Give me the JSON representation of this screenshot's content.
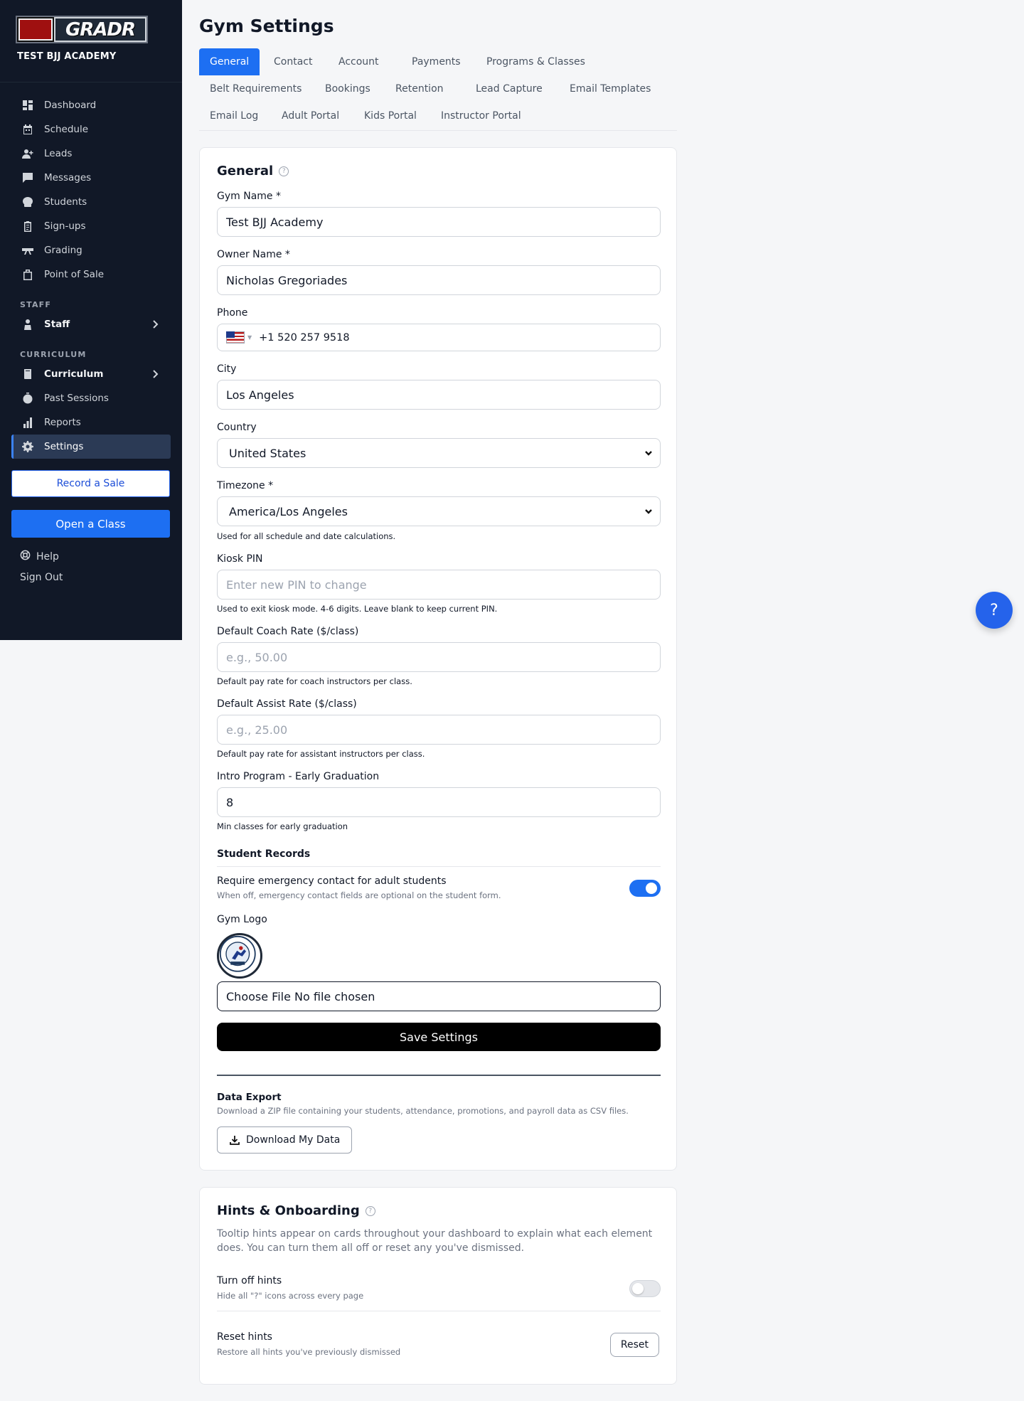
{
  "sidebar": {
    "logo_text": "GRADR",
    "gym_name": "TEST BJJ ACADEMY",
    "items": [
      {
        "label": "Dashboard",
        "icon": "dashboard-icon"
      },
      {
        "label": "Schedule",
        "icon": "calendar-icon"
      },
      {
        "label": "Leads",
        "icon": "person-add-icon"
      },
      {
        "label": "Messages",
        "icon": "chat-icon"
      },
      {
        "label": "Students",
        "icon": "users-icon"
      },
      {
        "label": "Sign-ups",
        "icon": "clipboard-icon"
      },
      {
        "label": "Grading",
        "icon": "belt-icon"
      },
      {
        "label": "Point of Sale",
        "icon": "shopping-bag-icon"
      }
    ],
    "staff_section": "STAFF",
    "staff_item": "Staff",
    "curriculum_section": "CURRICULUM",
    "curriculum_item": "Curriculum",
    "past_sessions": "Past Sessions",
    "reports": "Reports",
    "settings": "Settings",
    "record_sale": "Record a Sale",
    "open_class": "Open a Class",
    "help": "Help",
    "sign_out": "Sign Out"
  },
  "page": {
    "title": "Gym Settings",
    "tabs": [
      "General",
      "Contact",
      "Account",
      "Payments",
      "Programs & Classes",
      "Belt Requirements",
      "Bookings",
      "Retention",
      "Lead Capture",
      "Email Templates",
      "Email Log",
      "Adult Portal",
      "Kids Portal",
      "Instructor Portal"
    ],
    "active_tab": "General"
  },
  "general": {
    "title": "General",
    "gym_name_label": "Gym Name *",
    "gym_name_value": "Test BJJ Academy",
    "owner_label": "Owner Name *",
    "owner_value": "Nicholas Gregoriades",
    "phone_label": "Phone",
    "phone_value": "+1 520 257 9518",
    "city_label": "City",
    "city_value": "Los Angeles",
    "country_label": "Country",
    "country_value": "United States",
    "timezone_label": "Timezone *",
    "timezone_value": "America/Los Angeles",
    "timezone_hint": "Used for all schedule and date calculations.",
    "kiosk_label": "Kiosk PIN",
    "kiosk_placeholder": "Enter new PIN to change",
    "kiosk_hint": "Used to exit kiosk mode. 4-6 digits. Leave blank to keep current PIN.",
    "coach_label": "Default Coach Rate ($/class)",
    "coach_placeholder": "e.g., 50.00",
    "coach_hint": "Default pay rate for coach instructors per class.",
    "assist_label": "Default Assist Rate ($/class)",
    "assist_placeholder": "e.g., 25.00",
    "assist_hint": "Default pay rate for assistant instructors per class.",
    "intro_label": "Intro Program - Early Graduation",
    "intro_value": "8",
    "intro_hint": "Min classes for early graduation",
    "student_records": "Student Records",
    "emergency_label": "Require emergency contact for adult students",
    "emergency_hint": "When off, emergency contact fields are optional on the student form.",
    "emergency_on": true,
    "logo_label": "Gym Logo",
    "logo_badge_text": "TEST JIU-JITSU ACADEMY",
    "file_value": "Choose File No file chosen",
    "save": "Save Settings",
    "export_title": "Data Export",
    "export_desc": "Download a ZIP file containing your students, attendance, promotions, and payroll data as CSV files.",
    "download": "Download My Data"
  },
  "hints": {
    "title": "Hints & Onboarding",
    "desc": "Tooltip hints appear on cards throughout your dashboard to explain what each element does. You can turn them all off or reset any you've dismissed.",
    "turn_off_label": "Turn off hints",
    "turn_off_hint": "Hide all \"?\" icons across every page",
    "turn_off_on": false,
    "reset_label": "Reset hints",
    "reset_hint": "Restore all hints you've previously dismissed",
    "reset_button": "Reset"
  },
  "fab": "?",
  "colors": {
    "sidebar": "#111827",
    "accent": "#1d6ff2",
    "save": "#000000"
  }
}
